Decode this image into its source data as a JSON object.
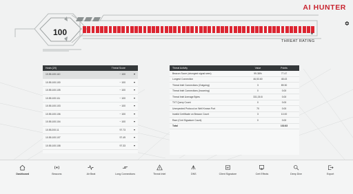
{
  "brand": {
    "logo_text": "AI HUNTER",
    "accent": "#c8242f"
  },
  "threat": {
    "score": "100",
    "rating_label": "THREAT RATING",
    "meter_segments": 54,
    "meter_color": "#dc2430"
  },
  "hosts_table": {
    "header_host": "Hosts [20]",
    "header_score": "Threat Score",
    "rows": [
      {
        "host": "10.55.100.110",
        "score": "~ 100"
      },
      {
        "host": "10.55.100.100",
        "score": "~ 100"
      },
      {
        "host": "10.55.100.105",
        "score": "~ 100"
      },
      {
        "host": "10.55.100.111",
        "score": "~ 100"
      },
      {
        "host": "10.55.100.103",
        "score": "~ 100"
      },
      {
        "host": "10.55.100.106",
        "score": "~ 100"
      },
      {
        "host": "10.55.100.104",
        "score": "~ 100"
      },
      {
        "host": "10.55.200.11",
        "score": "97.73"
      },
      {
        "host": "10.55.100.107",
        "score": "97.49"
      },
      {
        "host": "10.55.100.108",
        "score": "97.33"
      }
    ]
  },
  "activity_table": {
    "header_activity": "Threat Activity",
    "header_value": "Value",
    "header_points": "Points",
    "rows": [
      {
        "activity": "Beacon Score (strongest signal seen)",
        "value": "99.38%",
        "points": "77.47"
      },
      {
        "activity": "Longest Connection",
        "value": "46,53.60",
        "points": "48.43"
      },
      {
        "activity": "Threat Intel Connections (Outgoing)",
        "value": "3",
        "points": "89.30"
      },
      {
        "activity": "Threat Intel Connections (Incoming)",
        "value": "0",
        "points": "0.00"
      },
      {
        "activity": "Threat Intel Average Bytes",
        "value": "331,30.8",
        "points": "0.00"
      },
      {
        "activity": "TXT Query Count",
        "value": "0",
        "points": "0.00"
      },
      {
        "activity": "Unexpected Protocol on Well Known Port",
        "value": "70",
        "points": "0.00"
      },
      {
        "activity": "Invalid Certificate on Beacon Count",
        "value": "3",
        "points": "10.00"
      },
      {
        "activity": "Rare (Cert Signature Count)",
        "value": "0",
        "points": "0.00"
      }
    ],
    "total_label": "Total",
    "total_points": "102.63"
  },
  "nav": {
    "items": [
      {
        "label": "Dashboard",
        "icon": "home-icon"
      },
      {
        "label": "Beacons",
        "icon": "beacon-icon"
      },
      {
        "label": "Air Beat",
        "icon": "pulse-icon"
      },
      {
        "label": "Long Connections",
        "icon": "link-icon"
      },
      {
        "label": "Threat Intel",
        "icon": "warning-icon"
      },
      {
        "label": "DNS",
        "icon": "dns-icon"
      },
      {
        "label": "Client Signature",
        "icon": "signature-icon"
      },
      {
        "label": "Cert Effects",
        "icon": "certificate-icon"
      },
      {
        "label": "Deep Dive",
        "icon": "deep-dive-icon"
      },
      {
        "label": "Export",
        "icon": "export-icon"
      }
    ]
  }
}
